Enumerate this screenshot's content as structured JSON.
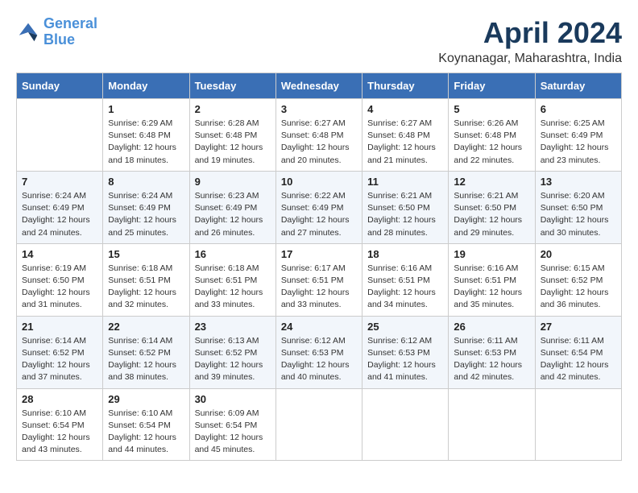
{
  "header": {
    "logo_line1": "General",
    "logo_line2": "Blue",
    "month_title": "April 2024",
    "location": "Koynanagar, Maharashtra, India"
  },
  "days_of_week": [
    "Sunday",
    "Monday",
    "Tuesday",
    "Wednesday",
    "Thursday",
    "Friday",
    "Saturday"
  ],
  "weeks": [
    [
      {
        "day": "",
        "info": ""
      },
      {
        "day": "1",
        "info": "Sunrise: 6:29 AM\nSunset: 6:48 PM\nDaylight: 12 hours and 18 minutes."
      },
      {
        "day": "2",
        "info": "Sunrise: 6:28 AM\nSunset: 6:48 PM\nDaylight: 12 hours and 19 minutes."
      },
      {
        "day": "3",
        "info": "Sunrise: 6:27 AM\nSunset: 6:48 PM\nDaylight: 12 hours and 20 minutes."
      },
      {
        "day": "4",
        "info": "Sunrise: 6:27 AM\nSunset: 6:48 PM\nDaylight: 12 hours and 21 minutes."
      },
      {
        "day": "5",
        "info": "Sunrise: 6:26 AM\nSunset: 6:48 PM\nDaylight: 12 hours and 22 minutes."
      },
      {
        "day": "6",
        "info": "Sunrise: 6:25 AM\nSunset: 6:49 PM\nDaylight: 12 hours and 23 minutes."
      }
    ],
    [
      {
        "day": "7",
        "info": "Sunrise: 6:24 AM\nSunset: 6:49 PM\nDaylight: 12 hours and 24 minutes."
      },
      {
        "day": "8",
        "info": "Sunrise: 6:24 AM\nSunset: 6:49 PM\nDaylight: 12 hours and 25 minutes."
      },
      {
        "day": "9",
        "info": "Sunrise: 6:23 AM\nSunset: 6:49 PM\nDaylight: 12 hours and 26 minutes."
      },
      {
        "day": "10",
        "info": "Sunrise: 6:22 AM\nSunset: 6:49 PM\nDaylight: 12 hours and 27 minutes."
      },
      {
        "day": "11",
        "info": "Sunrise: 6:21 AM\nSunset: 6:50 PM\nDaylight: 12 hours and 28 minutes."
      },
      {
        "day": "12",
        "info": "Sunrise: 6:21 AM\nSunset: 6:50 PM\nDaylight: 12 hours and 29 minutes."
      },
      {
        "day": "13",
        "info": "Sunrise: 6:20 AM\nSunset: 6:50 PM\nDaylight: 12 hours and 30 minutes."
      }
    ],
    [
      {
        "day": "14",
        "info": "Sunrise: 6:19 AM\nSunset: 6:50 PM\nDaylight: 12 hours and 31 minutes."
      },
      {
        "day": "15",
        "info": "Sunrise: 6:18 AM\nSunset: 6:51 PM\nDaylight: 12 hours and 32 minutes."
      },
      {
        "day": "16",
        "info": "Sunrise: 6:18 AM\nSunset: 6:51 PM\nDaylight: 12 hours and 33 minutes."
      },
      {
        "day": "17",
        "info": "Sunrise: 6:17 AM\nSunset: 6:51 PM\nDaylight: 12 hours and 33 minutes."
      },
      {
        "day": "18",
        "info": "Sunrise: 6:16 AM\nSunset: 6:51 PM\nDaylight: 12 hours and 34 minutes."
      },
      {
        "day": "19",
        "info": "Sunrise: 6:16 AM\nSunset: 6:51 PM\nDaylight: 12 hours and 35 minutes."
      },
      {
        "day": "20",
        "info": "Sunrise: 6:15 AM\nSunset: 6:52 PM\nDaylight: 12 hours and 36 minutes."
      }
    ],
    [
      {
        "day": "21",
        "info": "Sunrise: 6:14 AM\nSunset: 6:52 PM\nDaylight: 12 hours and 37 minutes."
      },
      {
        "day": "22",
        "info": "Sunrise: 6:14 AM\nSunset: 6:52 PM\nDaylight: 12 hours and 38 minutes."
      },
      {
        "day": "23",
        "info": "Sunrise: 6:13 AM\nSunset: 6:52 PM\nDaylight: 12 hours and 39 minutes."
      },
      {
        "day": "24",
        "info": "Sunrise: 6:12 AM\nSunset: 6:53 PM\nDaylight: 12 hours and 40 minutes."
      },
      {
        "day": "25",
        "info": "Sunrise: 6:12 AM\nSunset: 6:53 PM\nDaylight: 12 hours and 41 minutes."
      },
      {
        "day": "26",
        "info": "Sunrise: 6:11 AM\nSunset: 6:53 PM\nDaylight: 12 hours and 42 minutes."
      },
      {
        "day": "27",
        "info": "Sunrise: 6:11 AM\nSunset: 6:54 PM\nDaylight: 12 hours and 42 minutes."
      }
    ],
    [
      {
        "day": "28",
        "info": "Sunrise: 6:10 AM\nSunset: 6:54 PM\nDaylight: 12 hours and 43 minutes."
      },
      {
        "day": "29",
        "info": "Sunrise: 6:10 AM\nSunset: 6:54 PM\nDaylight: 12 hours and 44 minutes."
      },
      {
        "day": "30",
        "info": "Sunrise: 6:09 AM\nSunset: 6:54 PM\nDaylight: 12 hours and 45 minutes."
      },
      {
        "day": "",
        "info": ""
      },
      {
        "day": "",
        "info": ""
      },
      {
        "day": "",
        "info": ""
      },
      {
        "day": "",
        "info": ""
      }
    ]
  ]
}
